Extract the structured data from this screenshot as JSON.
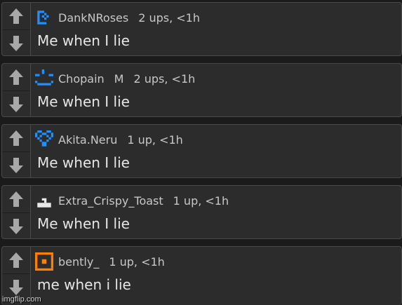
{
  "comments": [
    {
      "username": "DankNRoses",
      "flair": "",
      "stats": "2 ups, <1h",
      "text": "Me when I lie",
      "avatar_color": "#1e90ff",
      "avatar_icon": "pixel-d-icon"
    },
    {
      "username": "Chopain",
      "flair": "M",
      "stats": "2 ups, <1h",
      "text": "Me when I lie",
      "avatar_color": "#1e90ff",
      "avatar_icon": "pixel-face-icon"
    },
    {
      "username": "Akita.Neru",
      "flair": "",
      "stats": "1 up, <1h",
      "text": "Me when I lie",
      "avatar_color": "#1e90ff",
      "avatar_icon": "pixel-heart-icon"
    },
    {
      "username": "Extra_Crispy_Toast",
      "flair": "",
      "stats": "1 up, <1h",
      "text": "Me when I lie",
      "avatar_color": "#e8e8e8",
      "avatar_icon": "pixel-stairs-icon"
    },
    {
      "username": "bently_",
      "flair": "",
      "stats": "1 up, <1h",
      "text": "me when i lie",
      "avatar_color": "#ff7f00",
      "avatar_icon": "pixel-square-ring-icon"
    }
  ],
  "watermark": "imgflip.com",
  "colors": {
    "background": "#1b1b1b",
    "card": "#2c2c2c",
    "border": "#4a4a4a",
    "arrow": "#a8a8a8",
    "text": "#e6e6e6",
    "meta_text": "#c8c8c8"
  }
}
